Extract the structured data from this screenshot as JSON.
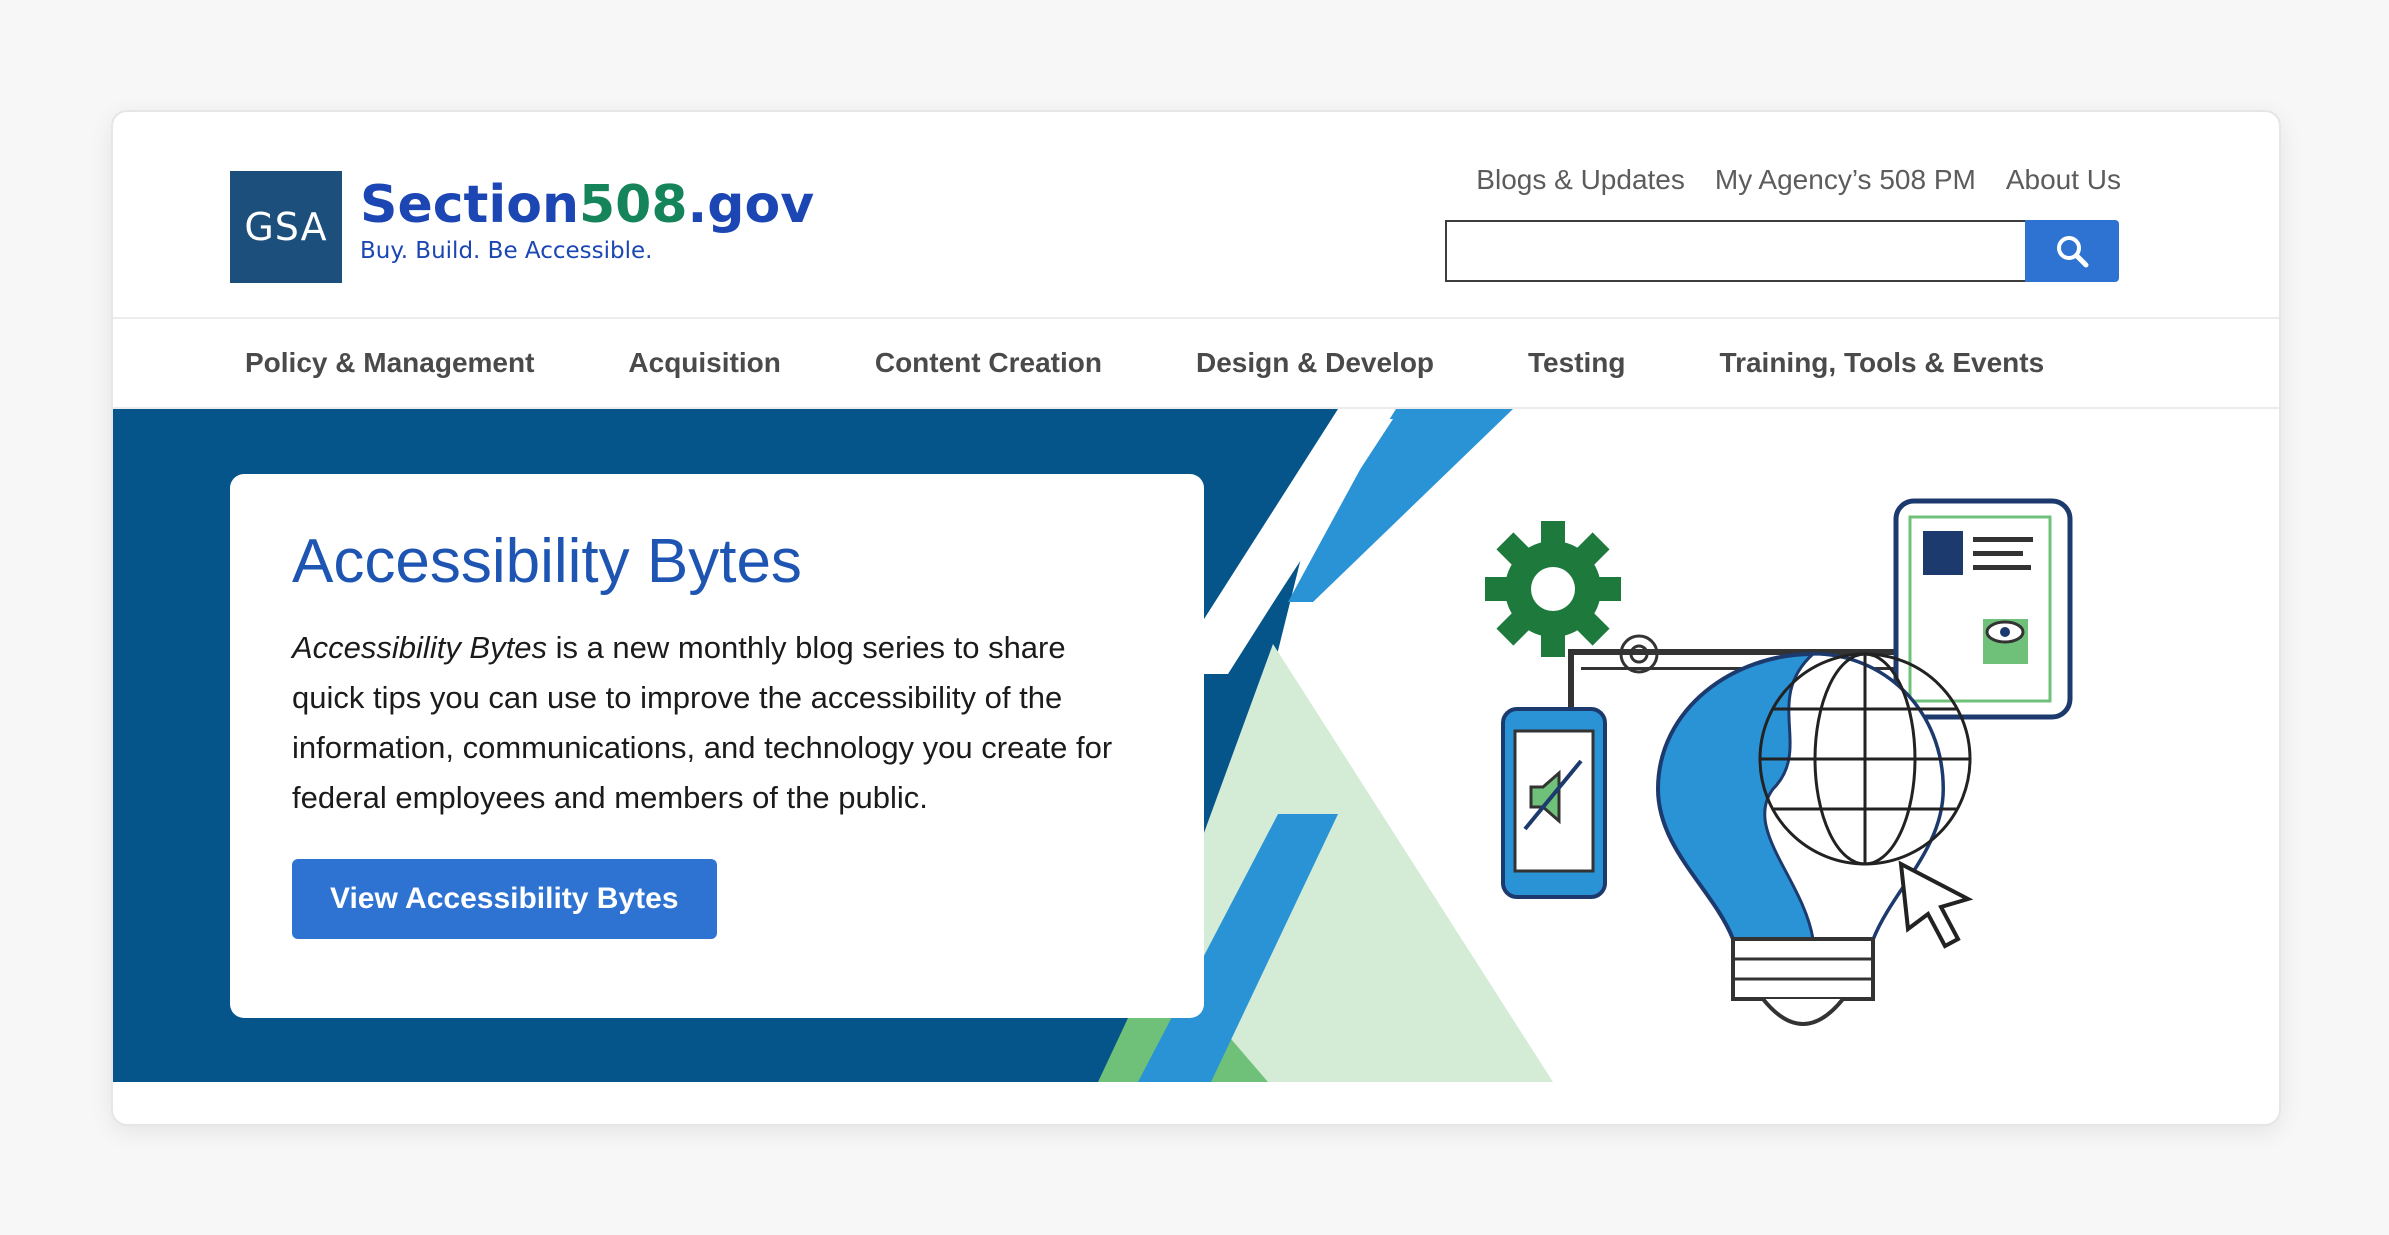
{
  "brand": {
    "logo_text": "GSA",
    "title_part1": "Section",
    "title_number": "508",
    "title_part2": ".gov",
    "tagline": "Buy. Build. Be Accessible."
  },
  "utility_nav": {
    "items": [
      {
        "label": "Blogs & Updates"
      },
      {
        "label": "My Agency’s 508 PM"
      },
      {
        "label": "About Us"
      }
    ]
  },
  "search": {
    "value": "",
    "icon": "search-icon"
  },
  "main_nav": {
    "items": [
      {
        "label": "Policy & Management"
      },
      {
        "label": "Acquisition"
      },
      {
        "label": "Content Creation"
      },
      {
        "label": "Design & Develop"
      },
      {
        "label": "Testing"
      },
      {
        "label": "Training, Tools & Events"
      }
    ]
  },
  "hero": {
    "title": "Accessibility Bytes",
    "body_italic": "Accessibility Bytes",
    "body_rest": " is a new monthly blog series to share quick tips you can use to improve the accessibility of the information, communications, and technology you create for federal employees and members of the public.",
    "button_label": "View Accessibility Bytes"
  },
  "colors": {
    "brand_blue": "#1b46b3",
    "brand_green": "#15845a",
    "hero_navy": "#05558a",
    "accent_blue": "#2e72d2",
    "light_blue": "#2a93d5",
    "pale_green": "#d4ecd6",
    "mid_green": "#6fc17a"
  }
}
